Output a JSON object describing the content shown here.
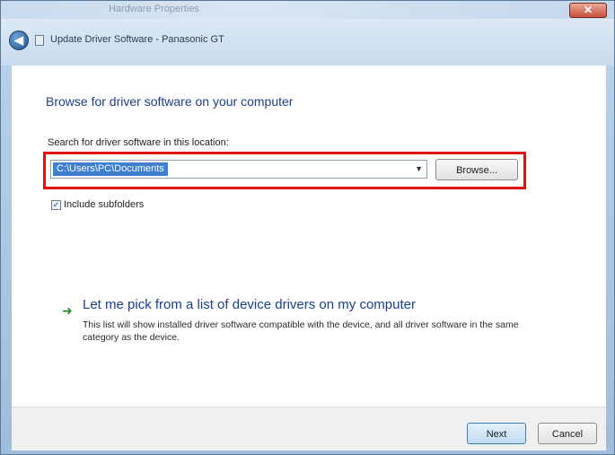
{
  "window": {
    "title": "Hardware Properties",
    "close_label": "✕"
  },
  "nav": {
    "back_label": "◀",
    "title": "Update Driver Software - Panasonic GT"
  },
  "main": {
    "heading": "Browse for driver software on your computer",
    "location_label": "Search for driver software in this location:",
    "location_value": "C:\\Users\\PC\\Documents",
    "browse_label": "Browse...",
    "include_subfolders_label": "Include subfolders",
    "include_subfolders_checked": true,
    "pick_link": "Let me pick from a list of device drivers on my computer",
    "pick_description": "This list will show installed driver software compatible with the device, and all driver software in the same category as the device."
  },
  "footer": {
    "next_label": "Next",
    "cancel_label": "Cancel"
  },
  "colors": {
    "highlight": "#e01010",
    "heading": "#1e3d8c",
    "link": "#1a3f8f"
  }
}
